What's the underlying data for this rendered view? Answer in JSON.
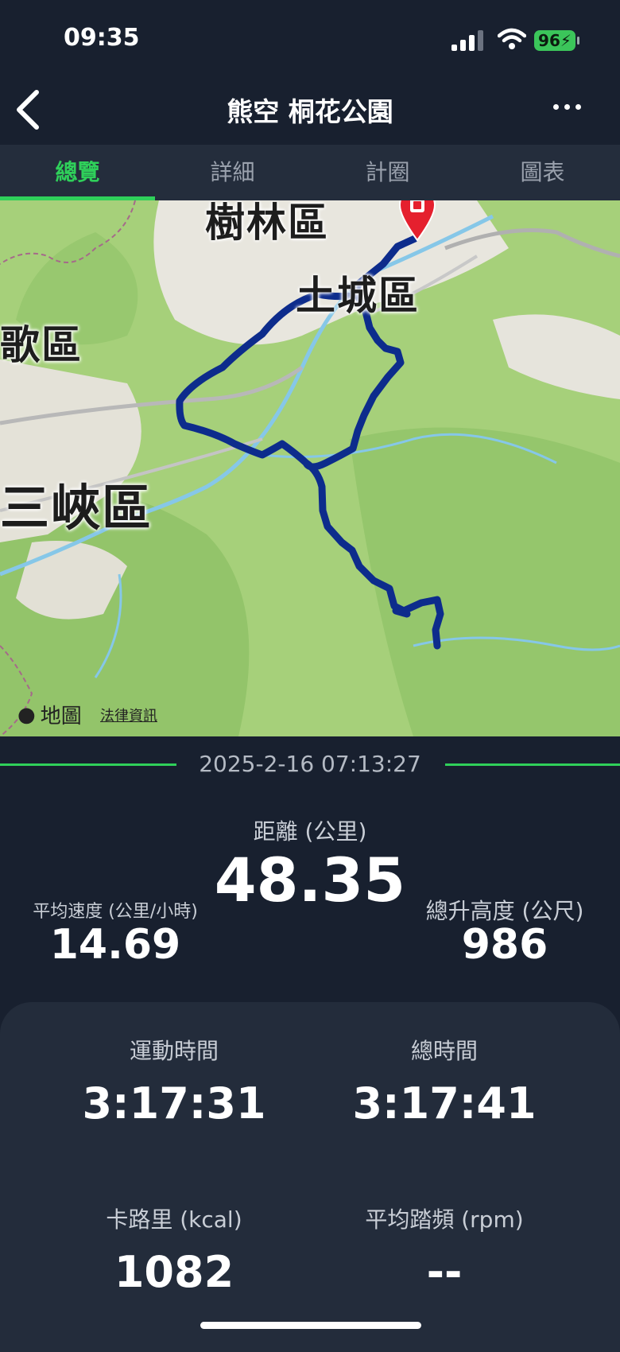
{
  "status_bar": {
    "time": "09:35",
    "battery": "96"
  },
  "header": {
    "title": "熊空 桐花公園"
  },
  "tabs": [
    {
      "label": "總覽",
      "active": true
    },
    {
      "label": "詳細",
      "active": false
    },
    {
      "label": "計圈",
      "active": false
    },
    {
      "label": "圖表",
      "active": false
    }
  ],
  "map": {
    "places": [
      "樹林區",
      "土城區",
      "歌區",
      "三峽區"
    ],
    "attribution": "地圖",
    "legal_link": "法律資訊",
    "route_color": "#0d2c8c",
    "marker_color": "#e5202e"
  },
  "activity": {
    "date": "2025-2-16 07:13:27",
    "distance": {
      "label": "距離 (公里)",
      "value": "48.35"
    },
    "avg_speed": {
      "label": "平均速度 (公里/小時)",
      "value": "14.69"
    },
    "elevation_gain": {
      "label": "總升高度 (公尺)",
      "value": "986"
    },
    "moving_time": {
      "label": "運動時間",
      "value": "3:17:31"
    },
    "total_time": {
      "label": "總時間",
      "value": "3:17:41"
    },
    "calories": {
      "label": "卡路里 (kcal)",
      "value": "1082"
    },
    "avg_cadence": {
      "label": "平均踏頻 (rpm)",
      "value": "--"
    }
  },
  "colors": {
    "accent": "#2fd05a",
    "background": "#18202f",
    "card": "#232c3b"
  }
}
